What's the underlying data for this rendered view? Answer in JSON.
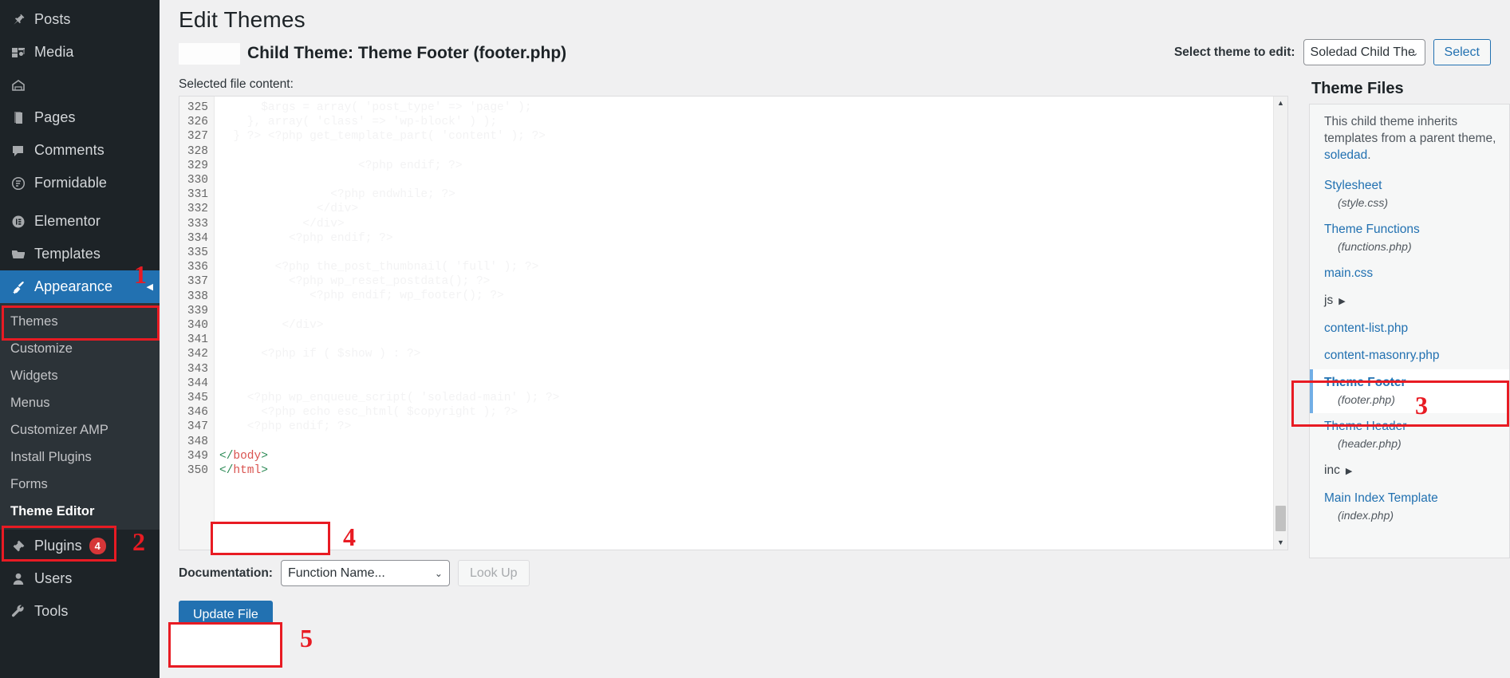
{
  "sidebar": {
    "items": [
      {
        "label": "Posts",
        "icon": "pin-icon",
        "state": "normal"
      },
      {
        "label": "Media",
        "icon": "media-icon",
        "state": "normal"
      },
      {
        "label": "",
        "icon": "home-icon",
        "state": "normal"
      },
      {
        "label": "Pages",
        "icon": "pages-icon",
        "state": "normal"
      },
      {
        "label": "Comments",
        "icon": "comment-icon",
        "state": "normal"
      },
      {
        "label": "Formidable",
        "icon": "formidable-icon",
        "state": "normal"
      },
      {
        "label": "Elementor",
        "icon": "elementor-icon",
        "state": "normal"
      },
      {
        "label": "Templates",
        "icon": "folder-icon",
        "state": "normal"
      },
      {
        "label": "Appearance",
        "icon": "brush-icon",
        "state": "active"
      }
    ],
    "submenu": [
      {
        "label": "Themes",
        "current": false
      },
      {
        "label": "Customize",
        "current": false
      },
      {
        "label": "Widgets",
        "current": false
      },
      {
        "label": "Menus",
        "current": false
      },
      {
        "label": "Customizer AMP",
        "current": false
      },
      {
        "label": "Install Plugins",
        "current": false
      },
      {
        "label": "Forms",
        "current": false
      },
      {
        "label": "Theme Editor",
        "current": true
      }
    ],
    "bottom_items": [
      {
        "label": "Plugins",
        "icon": "plug-icon",
        "badge": "4"
      },
      {
        "label": "Users",
        "icon": "user-icon",
        "badge": ""
      },
      {
        "label": "Tools",
        "icon": "wrench-icon",
        "badge": ""
      }
    ]
  },
  "header": {
    "page_title": "Edit Themes",
    "subhead_title": "Child Theme: Theme Footer (footer.php)",
    "theme_select_label": "Select theme to edit:",
    "theme_select_value": "Soledad Child The",
    "select_button": "Select"
  },
  "editor": {
    "selected_file_label": "Selected file content:",
    "first_line_number": 325,
    "last_line_number": 350,
    "lines": [
      {
        "n": 325,
        "text": "",
        "type": "blur"
      },
      {
        "n": 326,
        "text": "",
        "type": "blur"
      },
      {
        "n": 327,
        "text": "",
        "type": "blur"
      },
      {
        "n": 328,
        "text": "",
        "type": "blur"
      },
      {
        "n": 329,
        "text": "",
        "type": "blur"
      },
      {
        "n": 330,
        "text": "",
        "type": "blur"
      },
      {
        "n": 331,
        "text": "",
        "type": "blur"
      },
      {
        "n": 332,
        "text": "",
        "type": "blur"
      },
      {
        "n": 333,
        "text": "",
        "type": "blur"
      },
      {
        "n": 334,
        "text": "",
        "type": "blur"
      },
      {
        "n": 335,
        "text": "",
        "type": "blur"
      },
      {
        "n": 336,
        "text": "",
        "type": "blur"
      },
      {
        "n": 337,
        "text": "",
        "type": "blur"
      },
      {
        "n": 338,
        "text": "",
        "type": "blur"
      },
      {
        "n": 339,
        "text": "",
        "type": "blur"
      },
      {
        "n": 340,
        "text": "",
        "type": "blur"
      },
      {
        "n": 341,
        "text": "",
        "type": "blur"
      },
      {
        "n": 342,
        "text": "",
        "type": "blur"
      },
      {
        "n": 343,
        "text": "",
        "type": "blur"
      },
      {
        "n": 344,
        "text": "",
        "type": "blur"
      },
      {
        "n": 345,
        "text": "",
        "type": "blur"
      },
      {
        "n": 346,
        "text": "",
        "type": "blur"
      },
      {
        "n": 347,
        "text": "",
        "type": "blur"
      },
      {
        "n": 348,
        "text": "",
        "type": "blur"
      },
      {
        "n": 349,
        "text": "</body>",
        "type": "code"
      },
      {
        "n": 350,
        "text": "</html>",
        "type": "code"
      }
    ]
  },
  "files_panel": {
    "title": "Theme Files",
    "inherit_note_text": "This child theme inherits templates from a parent theme, ",
    "inherit_note_link": "soledad",
    "inherit_note_end": ".",
    "files": [
      {
        "name": "Stylesheet",
        "sub": "(style.css)",
        "kind": "file",
        "selected": false
      },
      {
        "name": "Theme Functions",
        "sub": "(functions.php)",
        "kind": "file",
        "selected": false
      },
      {
        "name": "main.css",
        "sub": "",
        "kind": "file",
        "selected": false
      },
      {
        "name": "js",
        "sub": "",
        "kind": "folder",
        "selected": false
      },
      {
        "name": "content-list.php",
        "sub": "",
        "kind": "file",
        "selected": false
      },
      {
        "name": "content-masonry.php",
        "sub": "",
        "kind": "file",
        "selected": false
      },
      {
        "name": "Theme Footer",
        "sub": "(footer.php)",
        "kind": "file",
        "selected": true
      },
      {
        "name": "Theme Header",
        "sub": "(header.php)",
        "kind": "file",
        "selected": false
      },
      {
        "name": "inc",
        "sub": "",
        "kind": "folder",
        "selected": false
      },
      {
        "name": "Main Index Template",
        "sub": "(index.php)",
        "kind": "file",
        "selected": false
      }
    ]
  },
  "footer_controls": {
    "documentation_label": "Documentation:",
    "documentation_value": "Function Name...",
    "lookup_button": "Look Up",
    "update_button": "Update File"
  },
  "annotations": {
    "color": "#e81b23",
    "steps": [
      {
        "number": "1",
        "target": "sidebar-appearance"
      },
      {
        "number": "2",
        "target": "sidebar-theme-editor"
      },
      {
        "number": "3",
        "target": "file-theme-footer"
      },
      {
        "number": "4",
        "target": "code-body-tag"
      },
      {
        "number": "5",
        "target": "update-file-button"
      }
    ]
  }
}
